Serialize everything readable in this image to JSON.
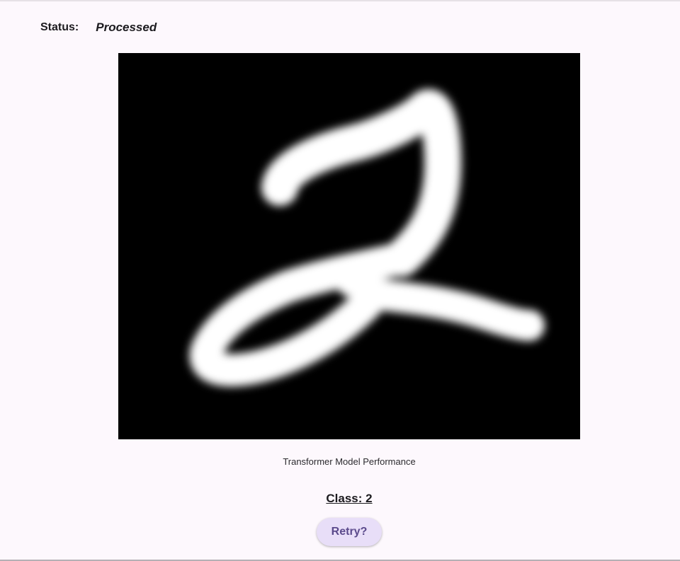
{
  "status": {
    "label": "Status:",
    "value": "Processed"
  },
  "image": {
    "description_icon": "handwritten-digit-image"
  },
  "caption": "Transformer Model Performance",
  "result": {
    "class_label": "Class: 2"
  },
  "actions": {
    "retry_label": "Retry?"
  },
  "colors": {
    "background": "#fdf8fd",
    "button_bg": "#e8def8",
    "button_text": "#5b4a8c"
  }
}
